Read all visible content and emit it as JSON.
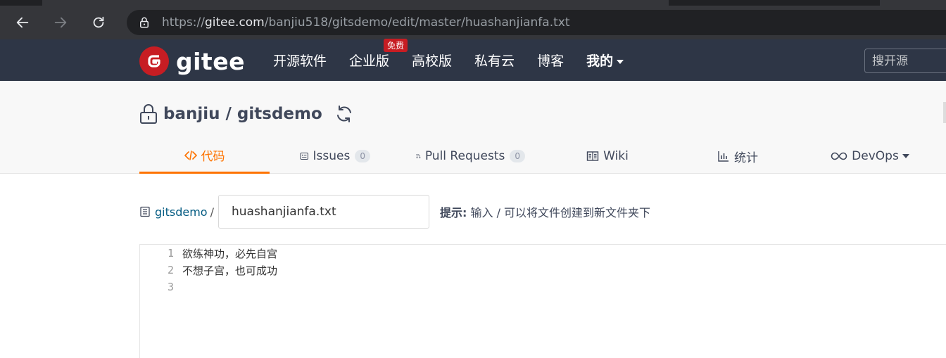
{
  "browser": {
    "url_prefix": "https://",
    "url_domain": "gitee.com",
    "url_path": "/banjiu518/gitsdemo/edit/master/huashanjianfa.txt"
  },
  "header": {
    "logo_text": "gitee",
    "nav": [
      {
        "label": "开源软件"
      },
      {
        "label": "企业版",
        "badge": "免费"
      },
      {
        "label": "高校版"
      },
      {
        "label": "私有云"
      },
      {
        "label": "博客"
      },
      {
        "label": "我的"
      }
    ],
    "search_placeholder": "搜开源"
  },
  "repo": {
    "title": "banjiu / gitsdemo",
    "tabs": [
      {
        "label": "代码",
        "icon": "code-icon",
        "active": true
      },
      {
        "label": "Issues",
        "count": "0",
        "icon": "issues-icon"
      },
      {
        "label": "Pull Requests",
        "count": "0",
        "icon": "pull-request-icon"
      },
      {
        "label": "Wiki",
        "icon": "wiki-icon"
      },
      {
        "label": "统计",
        "icon": "chart-icon"
      },
      {
        "label": "DevOps",
        "icon": "infinity-icon"
      }
    ]
  },
  "edit": {
    "breadcrumb_repo": "gitsdemo",
    "breadcrumb_sep": "/",
    "filename": "huashanjianfa.txt",
    "hint_label": "提示:",
    "hint_text": " 输入 / 可以将文件创建到新文件夹下"
  },
  "editor": {
    "lines": [
      {
        "no": "1",
        "text": "欲练神功，必先自宫"
      },
      {
        "no": "2",
        "text": "不想子宫，也可成功"
      },
      {
        "no": "3",
        "text": ""
      }
    ]
  },
  "colors": {
    "header_bg": "#2e3646",
    "accent": "#fe7300",
    "brand_red": "#c71d23"
  }
}
